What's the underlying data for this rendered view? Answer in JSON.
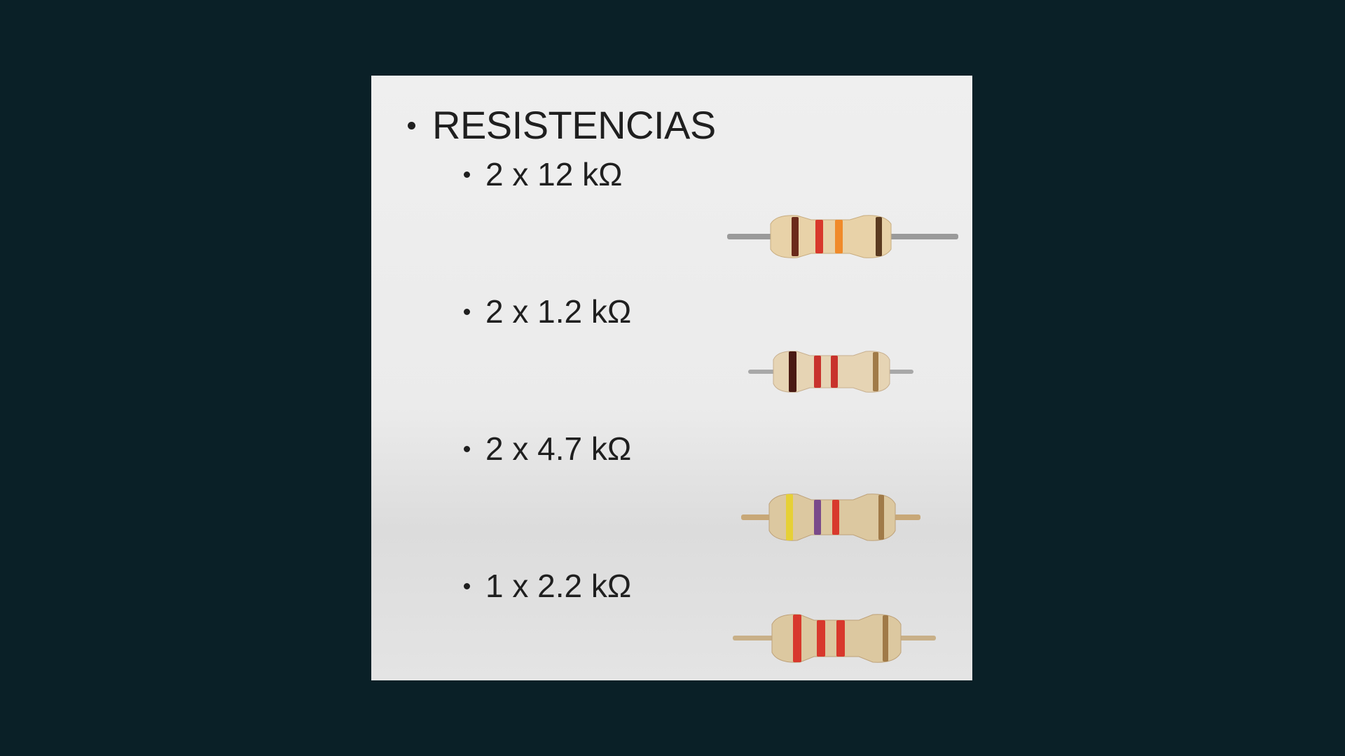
{
  "slide": {
    "heading": "RESISTENCIAS",
    "items": [
      {
        "label": "2 x 12 kΩ",
        "bands": [
          "#6b2a1a",
          "#d8382c",
          "#f08a2a",
          "#5a3a20"
        ]
      },
      {
        "label": "2 x 1.2 kΩ",
        "bands": [
          "#4a1a14",
          "#c8322c",
          "#c8322c",
          "#a07a48"
        ]
      },
      {
        "label": "2 x 4.7 kΩ",
        "bands": [
          "#e6d036",
          "#7a4a8a",
          "#d8382c",
          "#a07a48"
        ]
      },
      {
        "label": "1 x 2.2 kΩ",
        "bands": [
          "#d8382c",
          "#d8382c",
          "#d8382c",
          "#a07a48"
        ]
      }
    ]
  },
  "colors": {
    "background": "#0a2027",
    "slide": "#ebebeb",
    "text": "#1f1f1f",
    "resistor_body": "#e8d2a8",
    "lead": "#9a9a9a"
  }
}
